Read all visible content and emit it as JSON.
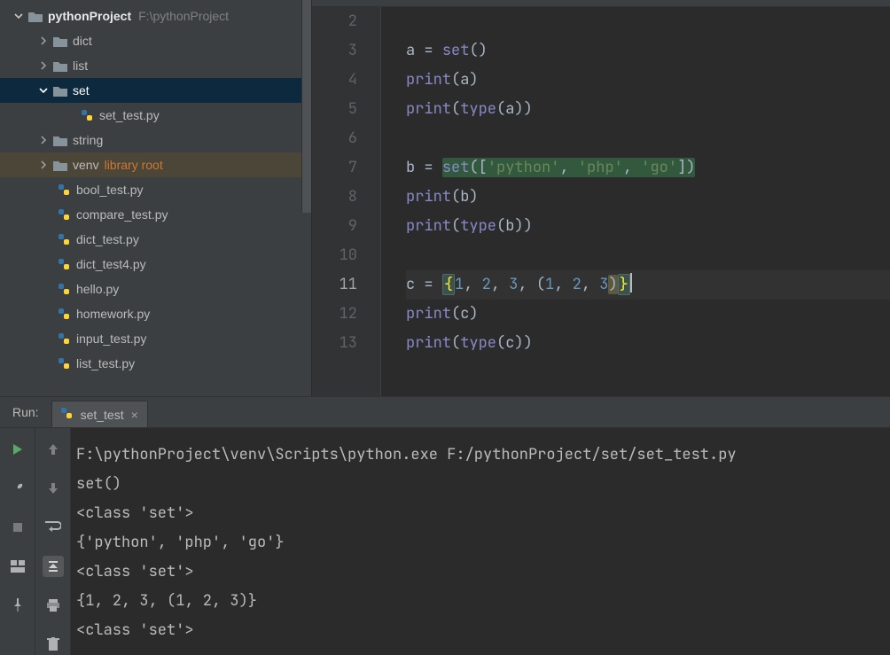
{
  "tree": {
    "root_label": "pythonProject",
    "root_path": "F:\\pythonProject",
    "folders": {
      "dict": "dict",
      "list": "list",
      "set": "set",
      "string": "string",
      "venv": "venv",
      "venv_tag": "library root"
    },
    "set_file": "set_test.py",
    "files": [
      "bool_test.py",
      "compare_test.py",
      "dict_test.py",
      "dict_test4.py",
      "hello.py",
      "homework.py",
      "input_test.py",
      "list_test.py"
    ]
  },
  "editor": {
    "first_line_no": 2,
    "last_line_no": 13,
    "current_line_no": 11
  },
  "code": {
    "l3_a": "a ",
    "l3_eq": "= ",
    "l3_set": "set",
    "l3_par": "()",
    "l4_print": "print",
    "l4_rest": "(a)",
    "l5_print": "print",
    "l5_p1": "(",
    "l5_type": "type",
    "l5_p2": "(a))",
    "l7_b": "b ",
    "l7_eq": "= ",
    "l7_set": "set",
    "l7_p1": "([",
    "l7_s1": "'python'",
    "l7_c1": ", ",
    "l7_s2": "'php'",
    "l7_c2": ", ",
    "l7_s3": "'go'",
    "l7_p2": "])",
    "l8_print": "print",
    "l8_rest": "(b)",
    "l9_print": "print",
    "l9_p1": "(",
    "l9_type": "type",
    "l9_p2": "(b))",
    "l11_c": "c ",
    "l11_eq": "= ",
    "l11_lb": "{",
    "l11_n1": "1",
    "l11_c1": ", ",
    "l11_n2": "2",
    "l11_c2": ", ",
    "l11_n3": "3",
    "l11_c3": ", (",
    "l11_n4": "1",
    "l11_c4": ", ",
    "l11_n5": "2",
    "l11_c5": ", ",
    "l11_n6": "3",
    "l11_c6": ")",
    "l11_rb": "}",
    "l12_print": "print",
    "l12_rest": "(c)",
    "l13_print": "print",
    "l13_p1": "(",
    "l13_type": "type",
    "l13_p2": "(c))"
  },
  "run": {
    "title": "Run:",
    "tab_label": "set_test",
    "lines": [
      "F:\\pythonProject\\venv\\Scripts\\python.exe F:/pythonProject/set/set_test.py",
      "set()",
      "<class 'set'>",
      "{'python', 'php', 'go'}",
      "<class 'set'>",
      "{1, 2, 3, (1, 2, 3)}",
      "<class 'set'>"
    ]
  }
}
